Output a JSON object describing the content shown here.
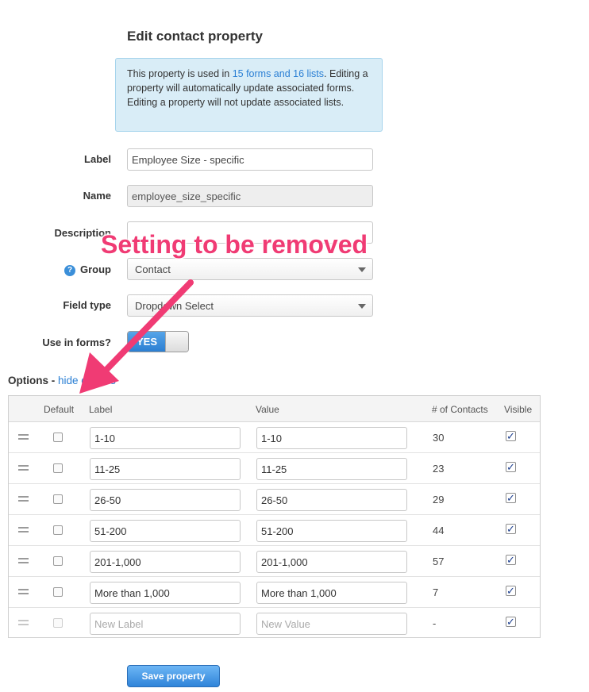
{
  "page": {
    "title": "Edit contact property"
  },
  "info": {
    "text_before": "This property is used in ",
    "link": "15 forms and 16 lists",
    "text_after": ". Editing a property will automatically update associated forms. Editing a property will not update associated lists."
  },
  "form": {
    "label_label": "Label",
    "label_value": "Employee Size - specific",
    "name_label": "Name",
    "name_value": "employee_size_specific",
    "description_label": "Description",
    "description_value": "",
    "group_label": "Group",
    "group_help_icon": "?",
    "group_value": "Contact",
    "fieldtype_label": "Field type",
    "fieldtype_value": "Dropdown Select",
    "useinforms_label": "Use in forms?",
    "useinforms_state": "YES"
  },
  "options": {
    "heading": "Options - ",
    "hide_link": "hide options",
    "columns": {
      "default": "Default",
      "label": "Label",
      "value": "Value",
      "contacts": "# of Contacts",
      "visible": "Visible"
    },
    "rows": [
      {
        "label": "1-10",
        "value": "1-10",
        "contacts": "30",
        "visible": true
      },
      {
        "label": "11-25",
        "value": "11-25",
        "contacts": "23",
        "visible": true
      },
      {
        "label": "26-50",
        "value": "26-50",
        "contacts": "29",
        "visible": true
      },
      {
        "label": "51-200",
        "value": "51-200",
        "contacts": "44",
        "visible": true
      },
      {
        "label": "201-1,000",
        "value": "201-1,000",
        "contacts": "57",
        "visible": true
      },
      {
        "label": "More than 1,000",
        "value": "More than 1,000",
        "contacts": "7",
        "visible": true
      }
    ],
    "new_row": {
      "label_placeholder": "New Label",
      "value_placeholder": "New Value",
      "contacts": "-",
      "visible": true
    }
  },
  "actions": {
    "save_label": "Save property"
  },
  "annotation": {
    "text": "Setting to be removed",
    "color": "#f03b74"
  },
  "colors": {
    "accent": "#2a7fd4",
    "info_bg": "#d9edf7"
  }
}
